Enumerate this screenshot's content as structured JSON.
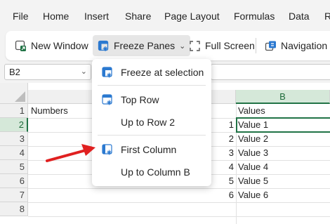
{
  "menu": [
    "File",
    "Home",
    "Insert",
    "Share",
    "Page Layout",
    "Formulas",
    "Data",
    "R"
  ],
  "toolbar": {
    "new_window": "New Window",
    "freeze_panes": "Freeze Panes",
    "full_screen": "Full Screen",
    "navigation": "Navigation"
  },
  "name_box": "B2",
  "freeze_menu": [
    {
      "label": "Freeze at selection",
      "icon": "freeze-selection-icon"
    },
    {
      "label": "Top Row",
      "icon": "freeze-top-row-icon"
    },
    {
      "label": "Up to Row 2",
      "icon": ""
    },
    {
      "label": "First Column",
      "icon": "freeze-first-column-icon"
    },
    {
      "label": "Up to Column B",
      "icon": ""
    }
  ],
  "sheet": {
    "selected_column": "B",
    "row_numbers": [
      "1",
      "2",
      "3",
      "4",
      "5",
      "6",
      "7",
      "8"
    ],
    "header_a": "Numbers",
    "header_b": "Values",
    "numbers": [
      "1",
      "2",
      "3",
      "4",
      "5",
      "6"
    ],
    "values": [
      "Value 1",
      "Value 2",
      "Value 3",
      "Value 4",
      "Value 5",
      "Value 6"
    ]
  },
  "colors": {
    "accent": "#217346",
    "freeze_icon": "#2b79d0",
    "arrow": "#e02020"
  }
}
